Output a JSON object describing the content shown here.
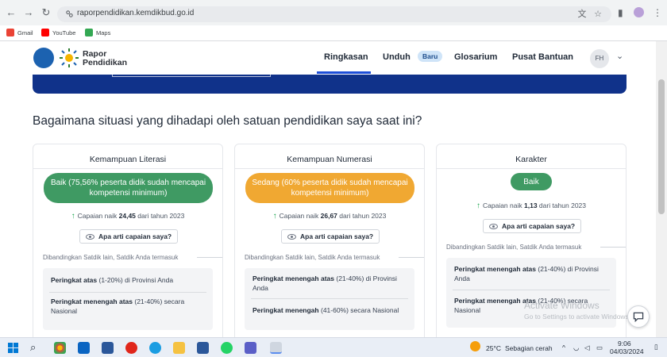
{
  "browser": {
    "url": "raporpendidikan.kemdikbud.go.id",
    "bookmarks": [
      {
        "label": "Gmail",
        "color": "#ea4335"
      },
      {
        "label": "YouTube",
        "color": "#ff0000"
      },
      {
        "label": "Maps",
        "color": "#34a853"
      }
    ]
  },
  "header": {
    "logo_line1": "Rapor",
    "logo_line2": "Pendidikan",
    "menu": [
      "Ringkasan",
      "Unduh",
      "Baru",
      "Glosarium",
      "Pusat Bantuan"
    ],
    "avatar": "FH"
  },
  "section_title": "Bagaimana situasi yang dihadapi oleh satuan pendidikan saya saat ini?",
  "cards": [
    {
      "title": "Kemampuan Literasi",
      "status": "Baik (75,56% peserta didik sudah mencapai kompetensi minimum)",
      "status_color": "#3f9a63",
      "delta_prefix": "Capaian naik",
      "delta_value": "24,45",
      "delta_suffix": "dari tahun 2023",
      "help": "Apa arti capaian saya?",
      "compare": "Dibandingkan Satdik lain, Satdik Anda termasuk",
      "rank1_bold": "Peringkat atas",
      "rank1_rest": "(1-20%) di Provinsi Anda",
      "rank2_bold": "Peringkat menengah atas",
      "rank2_rest": "(21-40%) secara Nasional"
    },
    {
      "title": "Kemampuan Numerasi",
      "status": "Sedang (60% peserta didik sudah mencapai kompetensi minimum)",
      "status_color": "#f0a832",
      "delta_prefix": "Capaian naik",
      "delta_value": "26,67",
      "delta_suffix": "dari tahun 2023",
      "help": "Apa arti capaian saya?",
      "compare": "Dibandingkan Satdik lain, Satdik Anda termasuk",
      "rank1_bold": "Peringkat menengah atas",
      "rank1_rest": "(21-40%) di Provinsi Anda",
      "rank2_bold": "Peringkat menengah",
      "rank2_rest": "(41-60%) secara Nasional"
    },
    {
      "title": "Karakter",
      "status": "Baik",
      "status_color": "#3f9a63",
      "delta_prefix": "Capaian naik",
      "delta_value": "1,13",
      "delta_suffix": "dari tahun 2023",
      "help": "Apa arti capaian saya?",
      "compare": "Dibandingkan Satdik lain, Satdik Anda termasuk",
      "rank1_bold": "Peringkat menengah atas",
      "rank1_rest": "(21-40%) di Provinsi Anda",
      "rank2_bold": "Peringkat menengah atas",
      "rank2_rest": "(21-40%) secara Nasional"
    }
  ],
  "watermark": {
    "line1": "Activate Windows",
    "line2": "Go to Settings to activate Windows."
  },
  "taskbar": {
    "weather": "25°C",
    "weather_desc": "Sebagian cerah",
    "time": "9:06",
    "date": "04/03/2024"
  }
}
